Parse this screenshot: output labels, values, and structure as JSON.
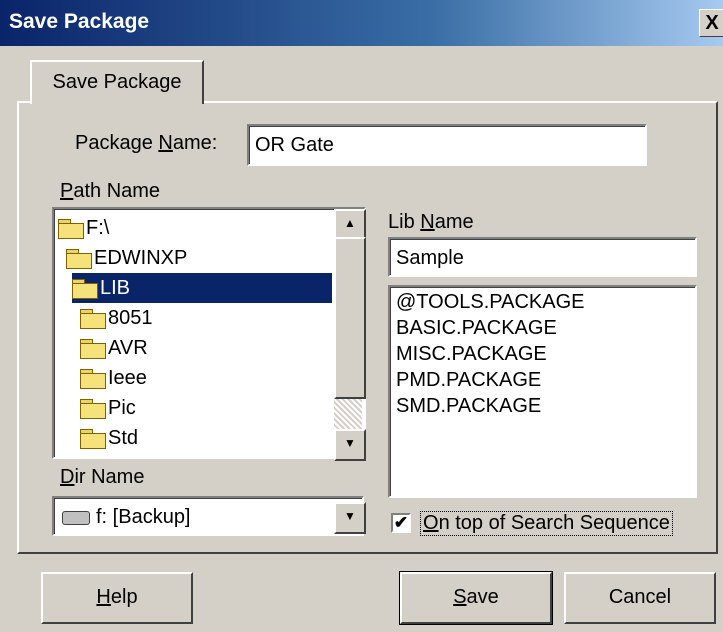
{
  "window": {
    "title": "Save Package",
    "close_label": "X"
  },
  "tab": {
    "label": "Save Package"
  },
  "package_name": {
    "label_pre": "Package ",
    "label_key": "N",
    "label_post": "ame:",
    "value": "OR Gate"
  },
  "path_name": {
    "label_key": "P",
    "label_post": "ath Name",
    "items": [
      {
        "name": "F:\\"
      },
      {
        "name": "EDWINXP"
      },
      {
        "name": "LIB"
      },
      {
        "name": "8051"
      },
      {
        "name": "AVR"
      },
      {
        "name": "Ieee"
      },
      {
        "name": "Pic"
      },
      {
        "name": "Std"
      }
    ],
    "selected": "LIB"
  },
  "dir_name": {
    "label_key": "D",
    "label_post": "ir Name",
    "value": "f: [Backup]"
  },
  "lib_name": {
    "label_pre": "Lib ",
    "label_key": "N",
    "label_post": "ame",
    "value": "Sample",
    "items": [
      "@TOOLS.PACKAGE",
      "BASIC.PACKAGE",
      "MISC.PACKAGE",
      "PMD.PACKAGE",
      "SMD.PACKAGE"
    ]
  },
  "on_top": {
    "label_key": "O",
    "label_post": "n top of Search Sequence",
    "checked": true,
    "check_glyph": "✔"
  },
  "buttons": {
    "help": {
      "key": "H",
      "rest": "elp"
    },
    "save": {
      "key": "S",
      "rest": "ave"
    },
    "cancel": {
      "label": "Cancel"
    }
  },
  "scroll_glyphs": {
    "up": "▲",
    "down": "▼"
  }
}
